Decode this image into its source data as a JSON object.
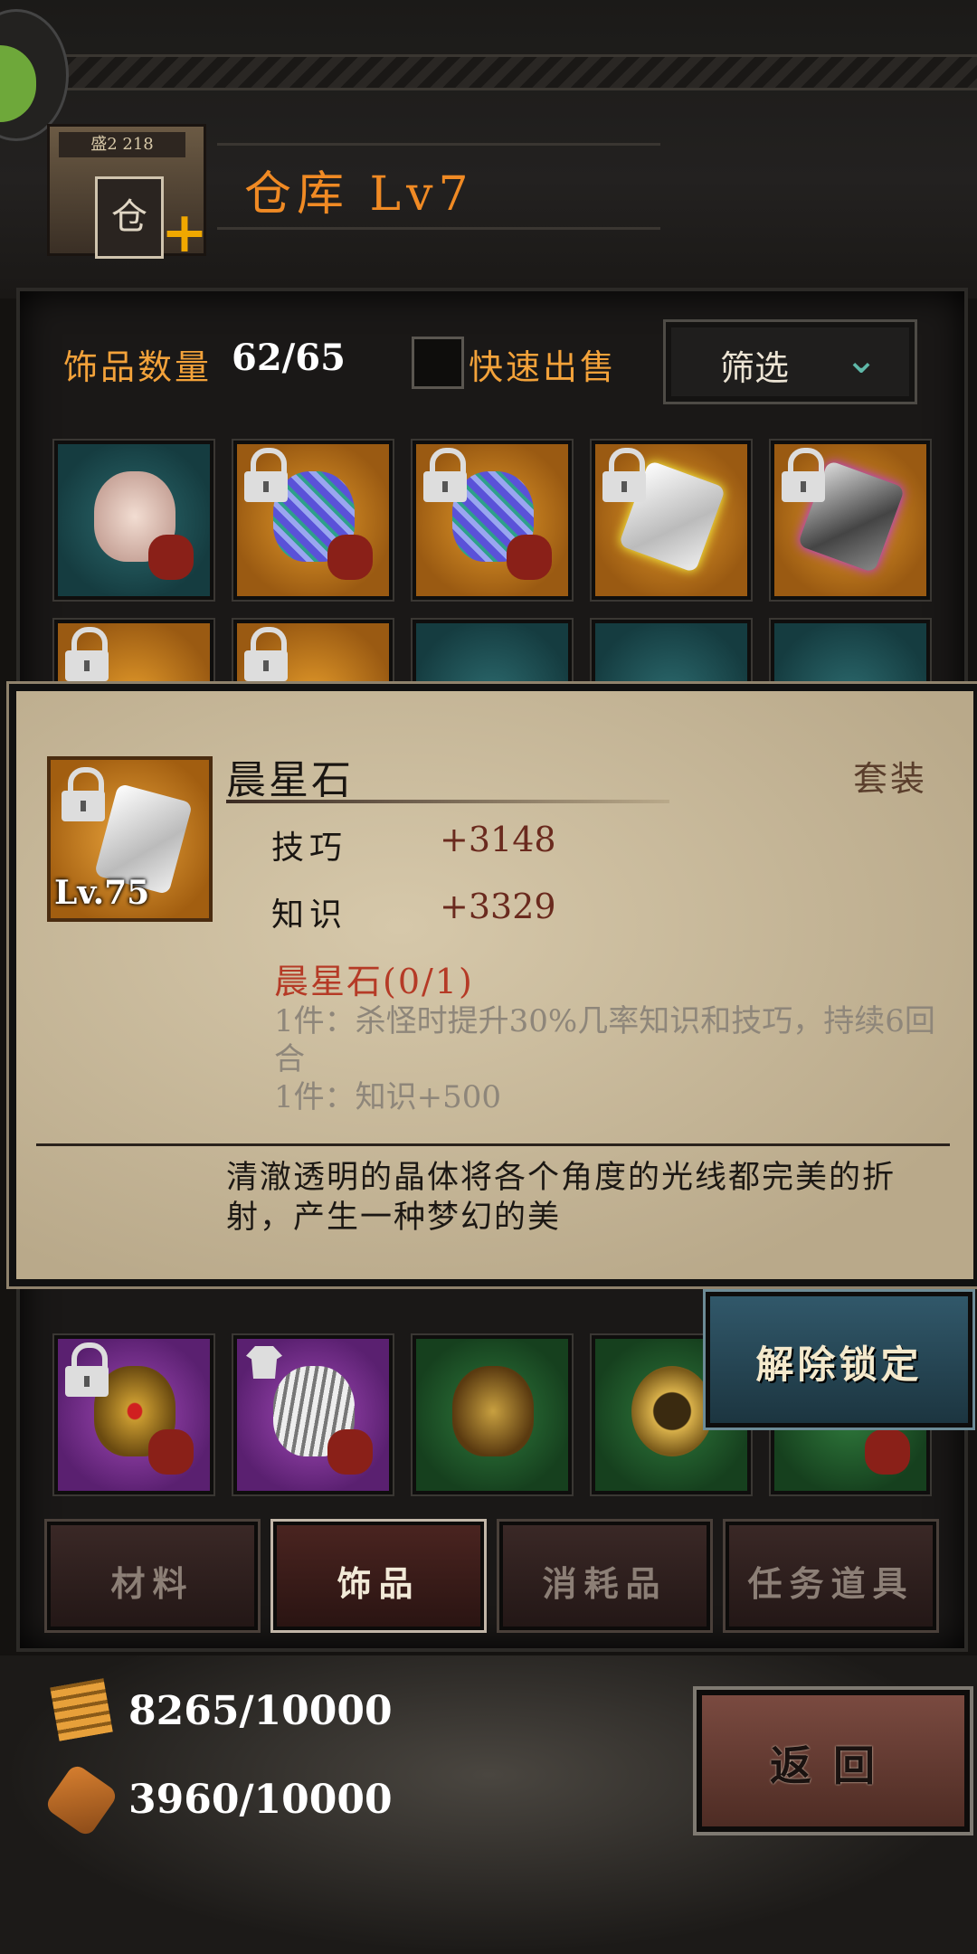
{
  "header": {
    "building_sign": "盛2 218",
    "building_door": "仓",
    "title": "仓库",
    "level": "Lv7"
  },
  "inventory": {
    "count_label": "饰品数量",
    "count_value": "62/65",
    "quick_sell_label": "快速出售",
    "filter_label": "筛选"
  },
  "popup": {
    "item_name": "晨星石",
    "item_level": "Lv.75",
    "set_tag": "套装",
    "stats": [
      {
        "name": "技巧",
        "value": "+3148"
      },
      {
        "name": "知识",
        "value": "+3329"
      }
    ],
    "set_title": "晨星石(0/1)",
    "set_effects": [
      "1件：杀怪时提升30%几率知识和技巧，持续6回合",
      "1件：知识+500"
    ],
    "flavor": "清澈透明的晶体将各个角度的光线都完美的折射，产生一种梦幻的美"
  },
  "unlock_button": "解除锁定",
  "tabs": [
    {
      "label": "材料",
      "active": false
    },
    {
      "label": "饰品",
      "active": true
    },
    {
      "label": "消耗品",
      "active": false
    },
    {
      "label": "任务道具",
      "active": false
    }
  ],
  "resources": [
    {
      "icon": "paper-stack-icon",
      "value": "8265/10000"
    },
    {
      "icon": "scroll-icon",
      "value": "3960/10000"
    }
  ],
  "back_button": "返回",
  "colors": {
    "accent_orange": "#f3a23a",
    "title_orange": "#f08a24",
    "set_red": "#b53a26",
    "teal_check": "#5fb8a8"
  }
}
